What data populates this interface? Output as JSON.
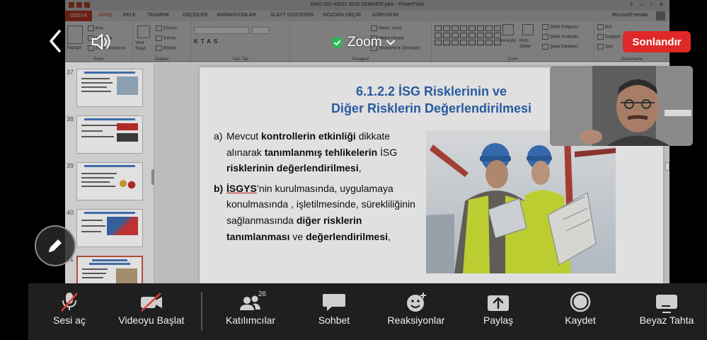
{
  "powerpoint": {
    "window_title": "KMO ISO 43001 2018  SEMINER.pptx - PowerPoint",
    "account": "Microsoft hesabı",
    "tabs": [
      "DOSYA",
      "GİRİŞ",
      "EKLE",
      "TASARIM",
      "GEÇİŞLER",
      "ANİMASYONLAR",
      "SLAYT GÖSTERİSİ",
      "GÖZDEN GEÇİR",
      "GÖRÜNÜM"
    ],
    "ribbon": {
      "pano": {
        "label": "Pano",
        "paste": "Yapıştır",
        "cut": "Kes",
        "copy": "Kopyala",
        "format_painter": "Biçim Boyacısı"
      },
      "slaytlar": {
        "label": "Slaytlar",
        "new_slide": "Yeni Slayt",
        "layout": "Düzen",
        "reset": "Sıfırla",
        "section": "Bölüm"
      },
      "yazi_tipi": {
        "label": "Yazı Tipi"
      },
      "paragraf": {
        "label": "Paragraf",
        "text_direction": "Metin Yönü",
        "align_text": "Metni Hizala",
        "smartart": "SmartArt'a Dönüştür"
      },
      "cizim": {
        "label": "Çizim",
        "arrange": "Yerleştir",
        "quick_styles": "Hızlı Stiller",
        "shape_fill": "Şekil Dolgusu",
        "shape_outline": "Şekil Anahattı",
        "shape_effects": "Şekil Efektleri"
      },
      "duzenleme": {
        "label": "Düzenleme",
        "find": "Bul",
        "replace": "Değiştir",
        "select": "Seç"
      }
    },
    "thumbnails": [
      {
        "number": "37",
        "selected": false
      },
      {
        "number": "38",
        "selected": false
      },
      {
        "number": "39",
        "selected": false
      },
      {
        "number": "40",
        "selected": false
      },
      {
        "number": "41",
        "selected": true
      }
    ],
    "slide": {
      "title_line1": "6.1.2.2  İSG Risklerinin ve",
      "title_line2": "Diğer Risklerin Değerlendirilmesi",
      "point_a": {
        "marker": "a)",
        "t1": " Mevcut ",
        "b1": "kontrollerin etkinliği",
        "t2": " dikkate alınarak ",
        "b2": "tanımlanmış tehlikelerin",
        "t3": " İSG ",
        "b3": "risklerinin değerlendirilmesi",
        "t4": ","
      },
      "point_b": {
        "marker": "b)",
        "u1": "İSGYS",
        "t1": "’nin kurulmasında, uygulamaya konulmasında , işletilmesinde, sürekliliğinin sağlanmasında ",
        "b1": "diğer risklerin tanımlanması",
        "t2": " ve ",
        "b2": "değerlendirilmesi",
        "t3": ","
      }
    }
  },
  "zoom": {
    "app_label": "Zoom",
    "end_button": "Sonlandır",
    "toolbar": [
      {
        "key": "mute",
        "label": "Sesi aç",
        "icon": "muted-mic-icon"
      },
      {
        "key": "video",
        "label": "Videoyu Başlat",
        "icon": "video-off-icon"
      },
      {
        "key": "participants",
        "label": "Katılımcılar",
        "icon": "participants-icon",
        "count": "26"
      },
      {
        "key": "chat",
        "label": "Sohbet",
        "icon": "chat-icon"
      },
      {
        "key": "reactions",
        "label": "Reaksiyonlar",
        "icon": "reactions-icon"
      },
      {
        "key": "share",
        "label": "Paylaş",
        "icon": "share-icon"
      },
      {
        "key": "record",
        "label": "Kaydet",
        "icon": "record-icon"
      },
      {
        "key": "whiteboard",
        "label": "Beyaz Tahta",
        "icon": "whiteboard-icon"
      }
    ],
    "colors": {
      "end_button": "#e02828",
      "toolbar_bg": "#1f1f1f",
      "shield": "#2fb84f"
    }
  }
}
